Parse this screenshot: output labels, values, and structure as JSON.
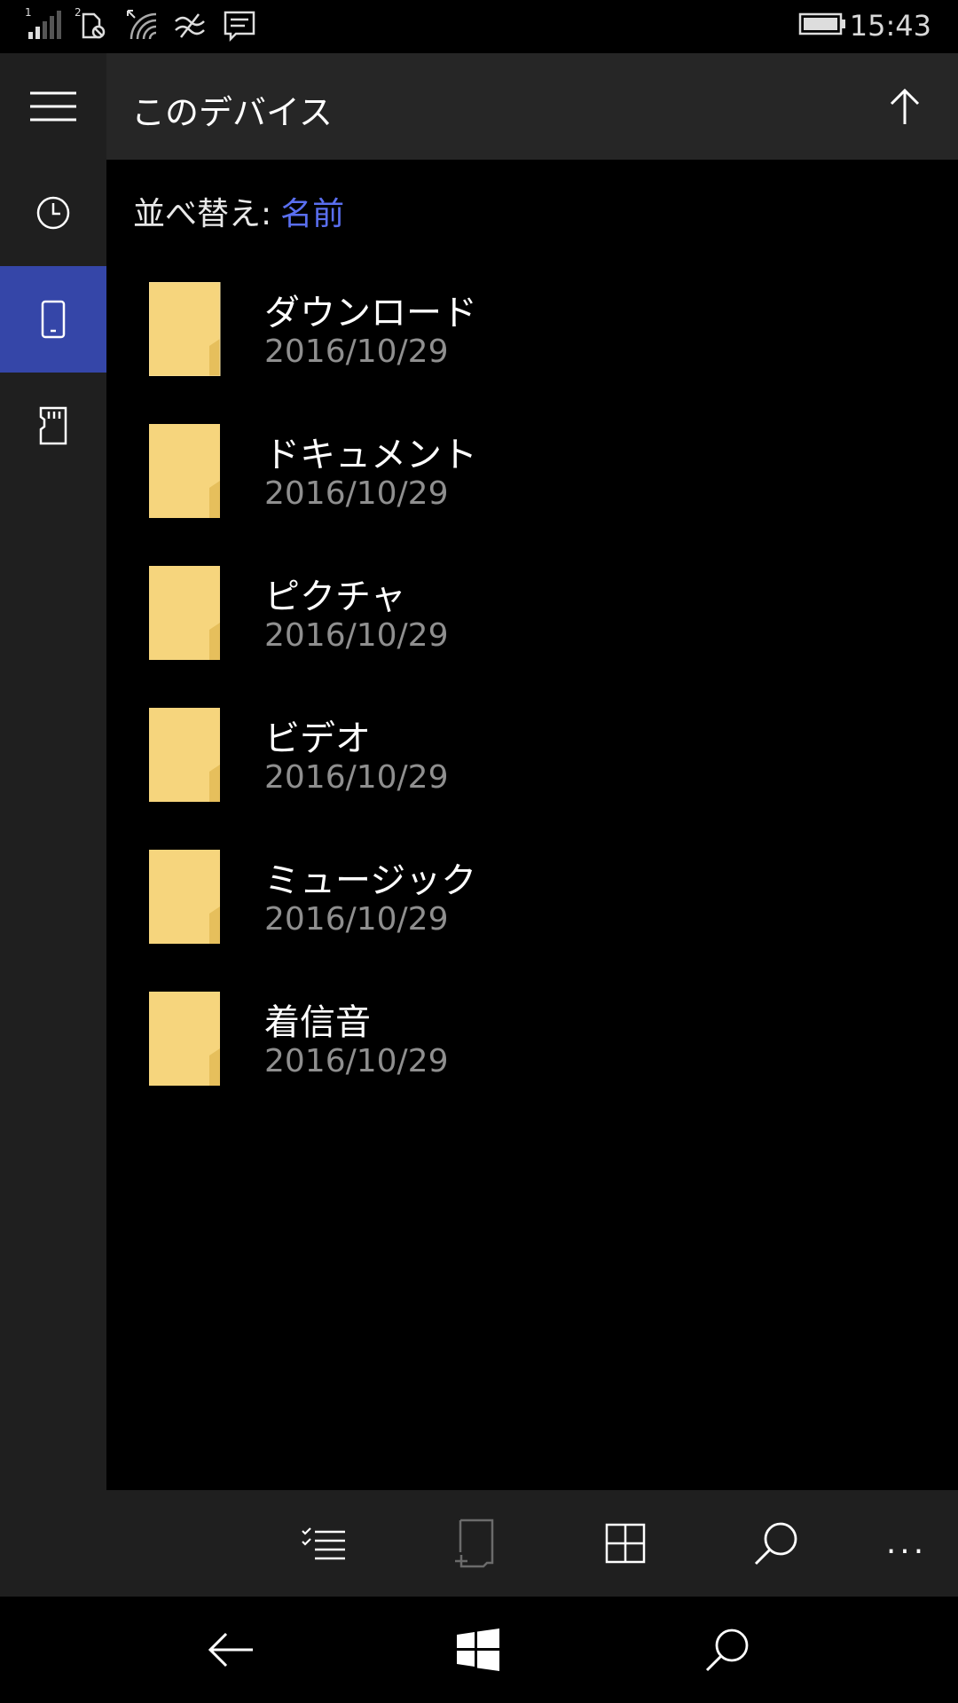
{
  "status_bar": {
    "time": "15:43",
    "sim1_label": "1",
    "sim2_label": "2",
    "icons": [
      "signal-icon",
      "sim-card-icon",
      "wifi-icon",
      "data-icon",
      "message-icon",
      "battery-icon"
    ]
  },
  "header": {
    "title": "このデバイス"
  },
  "sort": {
    "label": "並べ替え:",
    "value": "名前"
  },
  "folders": [
    {
      "name": "ダウンロード",
      "date": "2016/10/29"
    },
    {
      "name": "ドキュメント",
      "date": "2016/10/29"
    },
    {
      "name": "ピクチャ",
      "date": "2016/10/29"
    },
    {
      "name": "ビデオ",
      "date": "2016/10/29"
    },
    {
      "name": "ミュージック",
      "date": "2016/10/29"
    },
    {
      "name": "着信音",
      "date": "2016/10/29"
    }
  ],
  "rail": {
    "items": [
      "menu-icon",
      "recent-icon",
      "phone-icon",
      "sd-card-icon"
    ],
    "active_index": 2
  },
  "app_bar": {
    "items": [
      "select-icon",
      "new-folder-icon",
      "view-icon",
      "search-icon",
      "more-icon"
    ],
    "more_label": "..."
  },
  "nav_bar": {
    "items": [
      "back-icon",
      "windows-icon",
      "search-icon"
    ]
  },
  "colors": {
    "accent": "#3546a8",
    "link": "#5a6ff0",
    "folder": "#f7d77a"
  }
}
